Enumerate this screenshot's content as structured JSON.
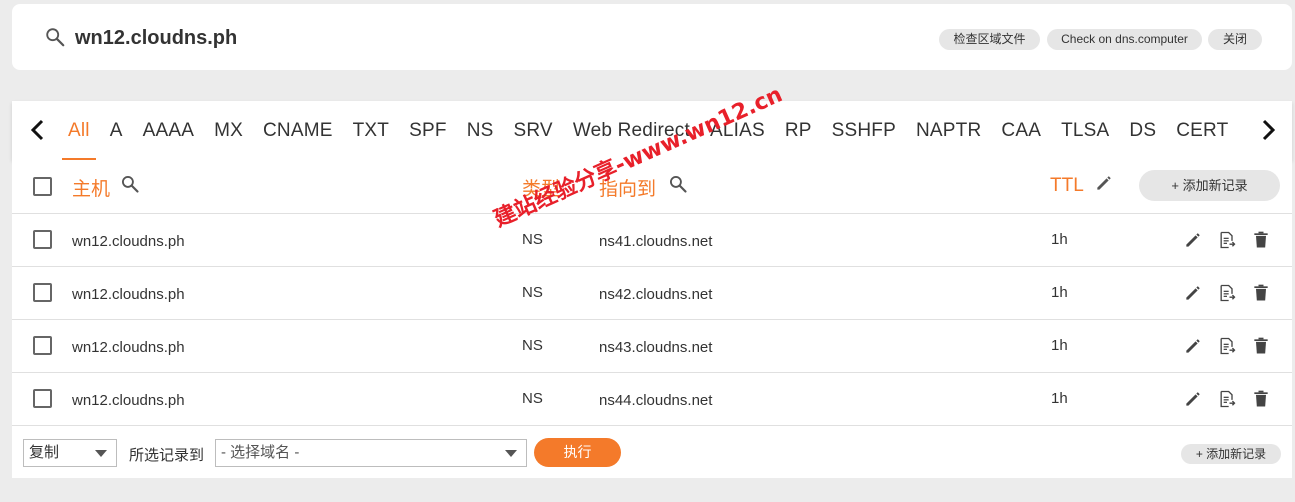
{
  "header": {
    "domain": "wn12.cloudns.ph",
    "buttons": {
      "check_zone": "检查区域文件",
      "check_dns_computer": "Check on dns.computer",
      "close": "关闭"
    }
  },
  "tabs": {
    "active": "All",
    "items": [
      "All",
      "A",
      "AAAA",
      "MX",
      "CNAME",
      "TXT",
      "SPF",
      "NS",
      "SRV",
      "Web Redirect",
      "ALIAS",
      "RP",
      "SSHFP",
      "NAPTR",
      "CAA",
      "TLSA",
      "DS",
      "CERT"
    ]
  },
  "table": {
    "headers": {
      "host": "主机",
      "type": "类型",
      "points_to": "指向到",
      "ttl": "TTL"
    },
    "add_record_label": "+ 添加新记录",
    "rows": [
      {
        "host": "wn12.cloudns.ph",
        "type": "NS",
        "points_to": "ns41.cloudns.net",
        "ttl": "1h"
      },
      {
        "host": "wn12.cloudns.ph",
        "type": "NS",
        "points_to": "ns42.cloudns.net",
        "ttl": "1h"
      },
      {
        "host": "wn12.cloudns.ph",
        "type": "NS",
        "points_to": "ns43.cloudns.net",
        "ttl": "1h"
      },
      {
        "host": "wn12.cloudns.ph",
        "type": "NS",
        "points_to": "ns44.cloudns.net",
        "ttl": "1h"
      }
    ]
  },
  "bottom": {
    "action_select": "复制",
    "move_label": "所选记录到",
    "domain_select_placeholder": "- 选择域名 -",
    "execute_label": "执行",
    "add_record_label": "+ 添加新记录"
  },
  "watermark": "建站经验分享-www.wn12.cn",
  "colors": {
    "accent": "#f47a2a",
    "watermark": "#e8202a"
  }
}
